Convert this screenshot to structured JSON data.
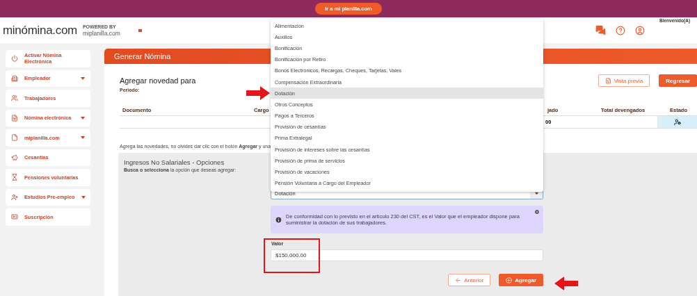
{
  "top_bar": {
    "button": "Ir a mi planilla.com"
  },
  "header": {
    "logo": "minómina.com",
    "powered_by": "POWERED BY",
    "partner": "miplanilla.com",
    "greeting": "Bienvenido(A)"
  },
  "sidebar": {
    "items": [
      {
        "label": "Activar Nómina Electrónica",
        "expandable": false
      },
      {
        "label": "Empleador",
        "expandable": true
      },
      {
        "label": "Trabajadores",
        "expandable": false
      },
      {
        "label": "Nómina electrónica",
        "expandable": true
      },
      {
        "label": "miplanilla.com",
        "expandable": true
      },
      {
        "label": "Cesantías",
        "expandable": false
      },
      {
        "label": "Pensiones voluntarias",
        "expandable": false
      },
      {
        "label": "Estudios Pre-empleo",
        "expandable": true
      },
      {
        "label": "Suscripción",
        "expandable": false
      }
    ]
  },
  "page": {
    "title": "Generar Nómina",
    "heading": "Agregar novedad para",
    "period_label": "Periodo:",
    "buttons": [
      {
        "label": "Vista previa",
        "kind": "outline"
      },
      {
        "label": "Regresar",
        "kind": "filled"
      }
    ],
    "table": {
      "columns": [
        "Documento",
        "Cargo",
        "jado",
        "Total devengados",
        "Estado"
      ],
      "row": {
        "column_3": "00"
      }
    },
    "hint": "Agrega las novedades, no olvides dar clic con el botón **Agregar** y una"
  },
  "options_panel": {
    "title": "Ingresos No Salariales - Opciones",
    "instruction": "**Busca o selecciona** la opción que deseas agregar:",
    "select": {
      "value": "Dotación",
      "expanded": true,
      "options": [
        {
          "label": "Alimentación",
          "selected": false
        },
        {
          "label": "Auxilios",
          "selected": false
        },
        {
          "label": "Bonificación",
          "selected": false
        },
        {
          "label": "Bonificación por Retiro",
          "selected": false
        },
        {
          "label": "Bonos Electrónicos, Recargas, Cheques, Tarjetas, Vales",
          "selected": false
        },
        {
          "label": "Compensación Extraordinaria",
          "selected": false
        },
        {
          "label": "Dotación",
          "selected": true
        },
        {
          "label": "Otros Conceptos",
          "selected": false
        },
        {
          "label": "Pagos a Terceros",
          "selected": false
        },
        {
          "label": "Provisión de cesantías",
          "selected": false
        },
        {
          "label": "Prima Extralegal",
          "selected": false
        },
        {
          "label": "Provisión de intereses sobre las cesantías",
          "selected": false
        },
        {
          "label": "Provisión de prima de servicios",
          "selected": false
        },
        {
          "label": "Provisión de vacaciones",
          "selected": false
        },
        {
          "label": "Pensión Voluntaria a Cargo del Empleador",
          "selected": false
        }
      ]
    },
    "info": "De conformidad con lo previsto en el artículo 230 del CST, es el Valor que el empleador dispone para suministrar la dotación de sus trabajadores.",
    "value_field": {
      "label": "Valor",
      "value": "$150,000.00"
    },
    "buttons": [
      {
        "label": "Anterior",
        "kind": "outline"
      },
      {
        "label": "Agregar",
        "kind": "filled"
      }
    ]
  }
}
